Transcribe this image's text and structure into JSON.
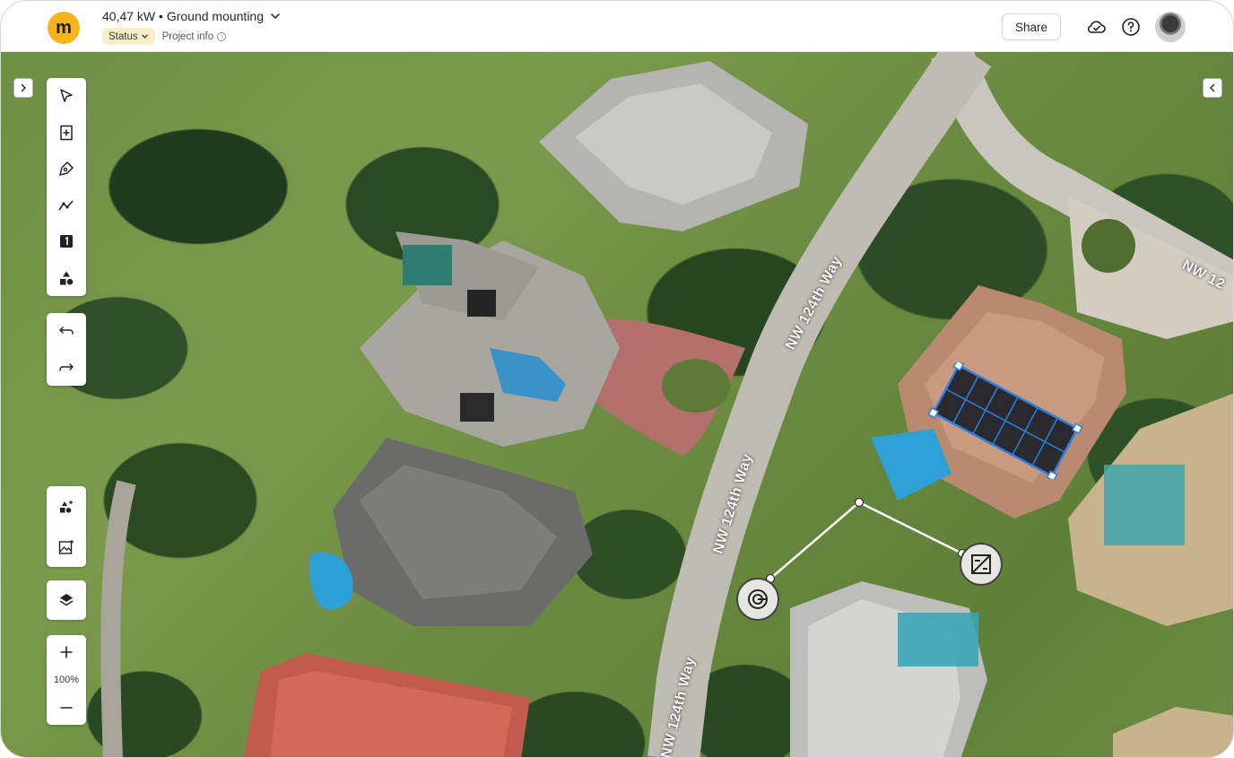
{
  "header": {
    "logo_letter": "m",
    "project_title": "40,47 kW • Ground mounting",
    "status_label": "Status",
    "project_info_label": "Project info",
    "share_label": "Share",
    "icons": [
      "cloud-check-icon",
      "help-icon",
      "user-avatar"
    ]
  },
  "map": {
    "road_labels": [
      "NW 124th Way",
      "NW 124th Way",
      "NW 124th Way",
      "NW 12"
    ],
    "solar_array": {
      "rows": 2,
      "columns": 6,
      "selected": true
    },
    "cable_markers": [
      "meter-icon",
      "inverter-icon"
    ]
  },
  "toolbar": {
    "tools": [
      "select-tool",
      "add-panel-tool",
      "draw-roof-tool",
      "measure-line-tool",
      "label-tool",
      "shapes-tool"
    ],
    "history": [
      "undo",
      "redo"
    ],
    "extras": [
      "add-obstruction",
      "import-image"
    ],
    "layers": "layers",
    "zoom": {
      "in": "+",
      "out": "−",
      "level": "100%"
    }
  },
  "colors": {
    "brand_yellow": "#f3b51b",
    "selection_blue": "#2b7fe0",
    "status_pill_bg": "#fbefc9"
  }
}
